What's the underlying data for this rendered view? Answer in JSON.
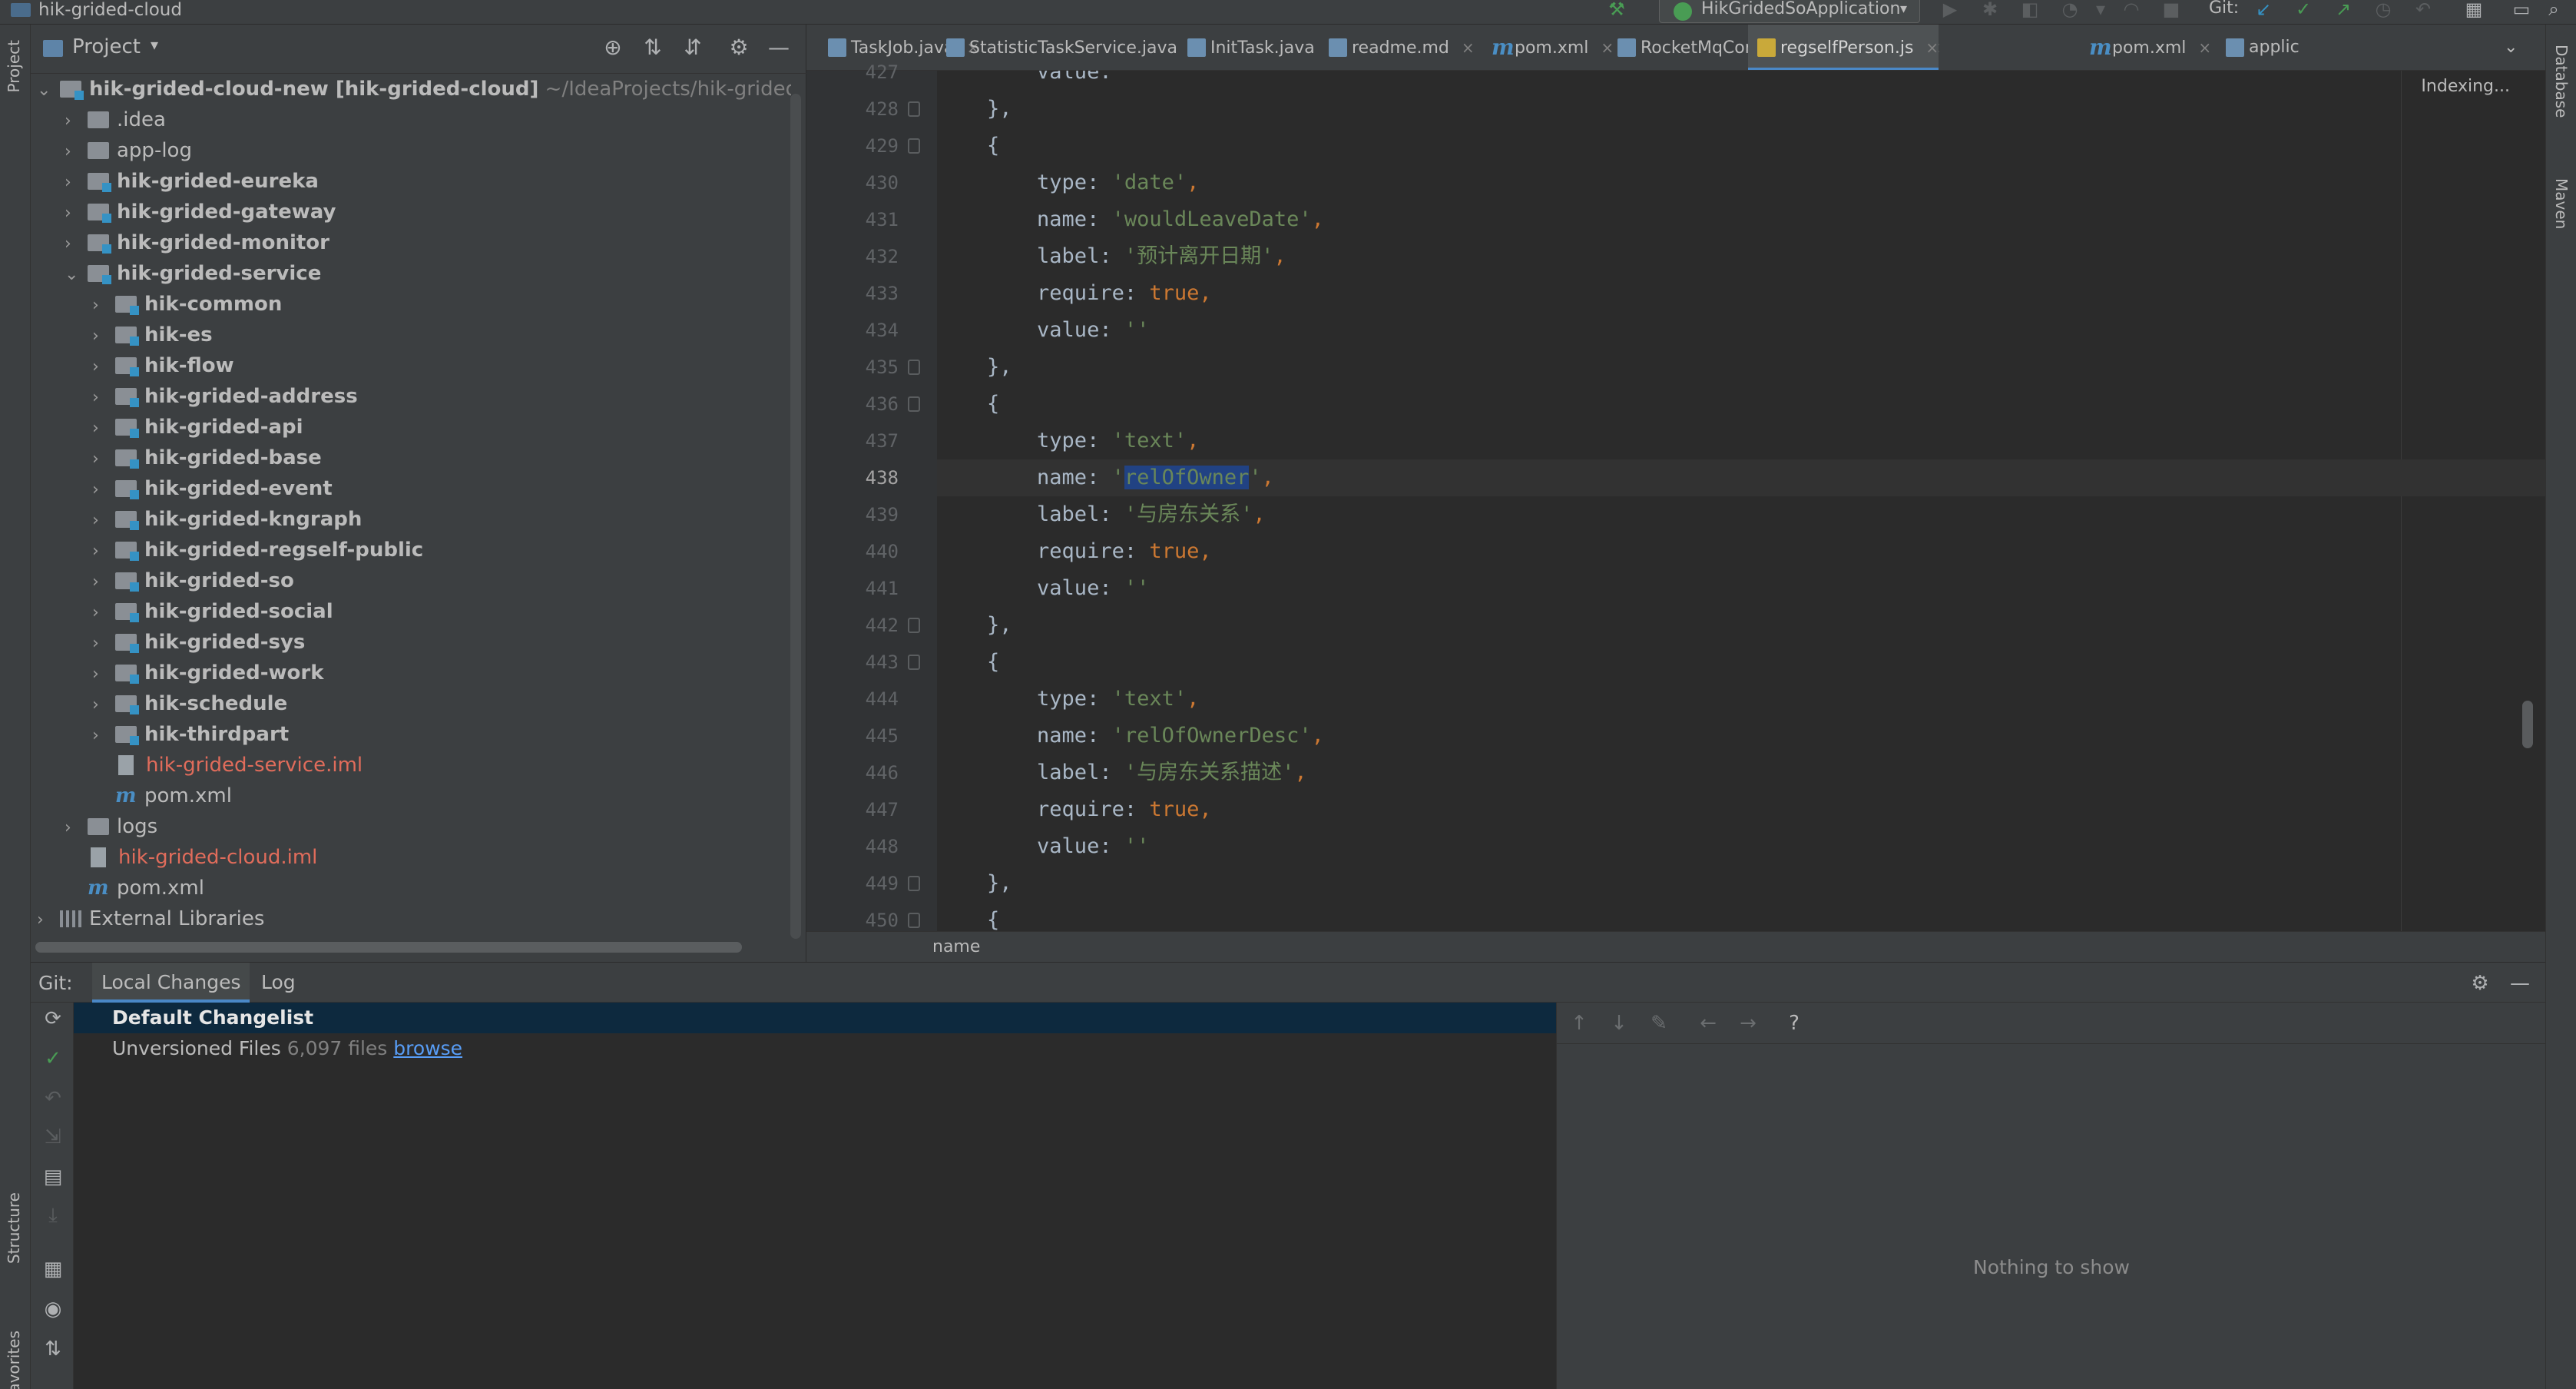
{
  "window": {
    "title": "hik-grided-cloud"
  },
  "toolbar": {
    "run_config": "HikGridedSoApplication",
    "git_label": "Git:"
  },
  "side_tabs": {
    "left_top": "Project",
    "left_structure": "Structure",
    "left_favorites": "Favorites",
    "right_database": "Database",
    "right_maven": "Maven"
  },
  "project_panel": {
    "title": "Project",
    "tree": [
      {
        "label": "hik-grided-cloud-new",
        "extra": "[hik-grided-cloud]",
        "path": "~/IdeaProjects/hik-grided-clo",
        "level": 0,
        "expanded": true,
        "type": "module"
      },
      {
        "label": ".idea",
        "level": 1,
        "expanded": false,
        "type": "folder"
      },
      {
        "label": "app-log",
        "level": 1,
        "expanded": false,
        "type": "folder"
      },
      {
        "label": "hik-grided-eureka",
        "level": 1,
        "expanded": false,
        "type": "module"
      },
      {
        "label": "hik-grided-gateway",
        "level": 1,
        "expanded": false,
        "type": "module"
      },
      {
        "label": "hik-grided-monitor",
        "level": 1,
        "expanded": false,
        "type": "module"
      },
      {
        "label": "hik-grided-service",
        "level": 1,
        "expanded": true,
        "type": "module"
      },
      {
        "label": "hik-common",
        "level": 2,
        "expanded": false,
        "type": "module"
      },
      {
        "label": "hik-es",
        "level": 2,
        "expanded": false,
        "type": "module"
      },
      {
        "label": "hik-flow",
        "level": 2,
        "expanded": false,
        "type": "module"
      },
      {
        "label": "hik-grided-address",
        "level": 2,
        "expanded": false,
        "type": "module"
      },
      {
        "label": "hik-grided-api",
        "level": 2,
        "expanded": false,
        "type": "module"
      },
      {
        "label": "hik-grided-base",
        "level": 2,
        "expanded": false,
        "type": "module"
      },
      {
        "label": "hik-grided-event",
        "level": 2,
        "expanded": false,
        "type": "module"
      },
      {
        "label": "hik-grided-kngraph",
        "level": 2,
        "expanded": false,
        "type": "module"
      },
      {
        "label": "hik-grided-regself-public",
        "level": 2,
        "expanded": false,
        "type": "module"
      },
      {
        "label": "hik-grided-so",
        "level": 2,
        "expanded": false,
        "type": "module"
      },
      {
        "label": "hik-grided-social",
        "level": 2,
        "expanded": false,
        "type": "module"
      },
      {
        "label": "hik-grided-sys",
        "level": 2,
        "expanded": false,
        "type": "module"
      },
      {
        "label": "hik-grided-work",
        "level": 2,
        "expanded": false,
        "type": "module"
      },
      {
        "label": "hik-schedule",
        "level": 2,
        "expanded": false,
        "type": "module"
      },
      {
        "label": "hik-thirdpart",
        "level": 2,
        "expanded": false,
        "type": "module"
      },
      {
        "label": "hik-grided-service.iml",
        "level": 2,
        "type": "iml"
      },
      {
        "label": "pom.xml",
        "level": 2,
        "type": "pom"
      },
      {
        "label": "logs",
        "level": 1,
        "expanded": false,
        "type": "folder"
      },
      {
        "label": "hik-grided-cloud.iml",
        "level": 1,
        "type": "iml"
      },
      {
        "label": "pom.xml",
        "level": 1,
        "type": "pom"
      },
      {
        "label": "External Libraries",
        "level": 0,
        "expanded": false,
        "type": "libs"
      }
    ]
  },
  "editor_tabs": [
    {
      "label": "TaskJob.java",
      "icon": "java-class-icon",
      "active": false
    },
    {
      "label": "StatisticTaskService.java",
      "icon": "java-class-icon",
      "active": false
    },
    {
      "label": "InitTask.java",
      "icon": "java-class-icon",
      "active": false
    },
    {
      "label": "readme.md",
      "icon": "markdown-icon",
      "active": false
    },
    {
      "label": "pom.xml",
      "icon": "maven-icon",
      "active": false
    },
    {
      "label": "RocketMqConsumerListener.java",
      "icon": "java-class-icon",
      "active": false
    },
    {
      "label": "regselfPerson.js",
      "icon": "javascript-icon",
      "active": true
    },
    {
      "label": "pom.xml",
      "icon": "maven-icon",
      "active": false
    },
    {
      "label": "applic",
      "icon": "yaml-icon",
      "active": false
    }
  ],
  "editor": {
    "status": "Indexing...",
    "current_line": 438,
    "lines": [
      {
        "num": "427",
        "tokens": [
          [
            "p",
            "        value: "
          ],
          [
            "s",
            "''"
          ]
        ]
      },
      {
        "num": "428",
        "tokens": [
          [
            "p",
            "    },"
          ]
        ]
      },
      {
        "num": "429",
        "tokens": [
          [
            "p",
            "    {"
          ]
        ]
      },
      {
        "num": "430",
        "tokens": [
          [
            "p",
            "        type: "
          ],
          [
            "s",
            "'date'"
          ],
          [
            "k",
            ","
          ]
        ]
      },
      {
        "num": "431",
        "tokens": [
          [
            "p",
            "        name: "
          ],
          [
            "s",
            "'wouldLeaveDate'"
          ],
          [
            "k",
            ","
          ]
        ]
      },
      {
        "num": "432",
        "tokens": [
          [
            "p",
            "        label: "
          ],
          [
            "s",
            "'预计离开日期'"
          ],
          [
            "k",
            ","
          ]
        ]
      },
      {
        "num": "433",
        "tokens": [
          [
            "p",
            "        require: "
          ],
          [
            "k",
            "true,"
          ]
        ]
      },
      {
        "num": "434",
        "tokens": [
          [
            "p",
            "        value: "
          ],
          [
            "s",
            "''"
          ]
        ]
      },
      {
        "num": "435",
        "tokens": [
          [
            "p",
            "    },"
          ]
        ]
      },
      {
        "num": "436",
        "tokens": [
          [
            "p",
            "    {"
          ]
        ]
      },
      {
        "num": "437",
        "tokens": [
          [
            "p",
            "        type: "
          ],
          [
            "s",
            "'text'"
          ],
          [
            "k",
            ","
          ]
        ]
      },
      {
        "num": "438",
        "tokens": [
          [
            "p",
            "        name: "
          ],
          [
            "s",
            "'"
          ],
          [
            "h",
            "relOfOwner"
          ],
          [
            "s",
            "'"
          ],
          [
            "k",
            ","
          ]
        ]
      },
      {
        "num": "439",
        "tokens": [
          [
            "p",
            "        label: "
          ],
          [
            "s",
            "'与房东关系'"
          ],
          [
            "k",
            ","
          ]
        ]
      },
      {
        "num": "440",
        "tokens": [
          [
            "p",
            "        require: "
          ],
          [
            "k",
            "true,"
          ]
        ]
      },
      {
        "num": "441",
        "tokens": [
          [
            "p",
            "        value: "
          ],
          [
            "s",
            "''"
          ]
        ]
      },
      {
        "num": "442",
        "tokens": [
          [
            "p",
            "    },"
          ]
        ]
      },
      {
        "num": "443",
        "tokens": [
          [
            "p",
            "    {"
          ]
        ]
      },
      {
        "num": "444",
        "tokens": [
          [
            "p",
            "        type: "
          ],
          [
            "s",
            "'text'"
          ],
          [
            "k",
            ","
          ]
        ]
      },
      {
        "num": "445",
        "tokens": [
          [
            "p",
            "        name: "
          ],
          [
            "s",
            "'relOfOwnerDesc'"
          ],
          [
            "k",
            ","
          ]
        ]
      },
      {
        "num": "446",
        "tokens": [
          [
            "p",
            "        label: "
          ],
          [
            "s",
            "'与房东关系描述'"
          ],
          [
            "k",
            ","
          ]
        ]
      },
      {
        "num": "447",
        "tokens": [
          [
            "p",
            "        require: "
          ],
          [
            "k",
            "true,"
          ]
        ]
      },
      {
        "num": "448",
        "tokens": [
          [
            "p",
            "        value: "
          ],
          [
            "s",
            "''"
          ]
        ]
      },
      {
        "num": "449",
        "tokens": [
          [
            "p",
            "    },"
          ]
        ]
      },
      {
        "num": "450",
        "tokens": [
          [
            "p",
            "    {"
          ]
        ]
      }
    ],
    "breadcrumb": "name"
  },
  "git_panel": {
    "label": "Git:",
    "tabs": [
      {
        "label": "Local Changes",
        "active": true
      },
      {
        "label": "Log",
        "active": false
      }
    ],
    "changelist": "Default Changelist",
    "unversioned_label": "Unversioned Files",
    "unversioned_count": "6,097 files",
    "browse_link": "browse",
    "diff_empty": "Nothing to show",
    "help": "?"
  }
}
